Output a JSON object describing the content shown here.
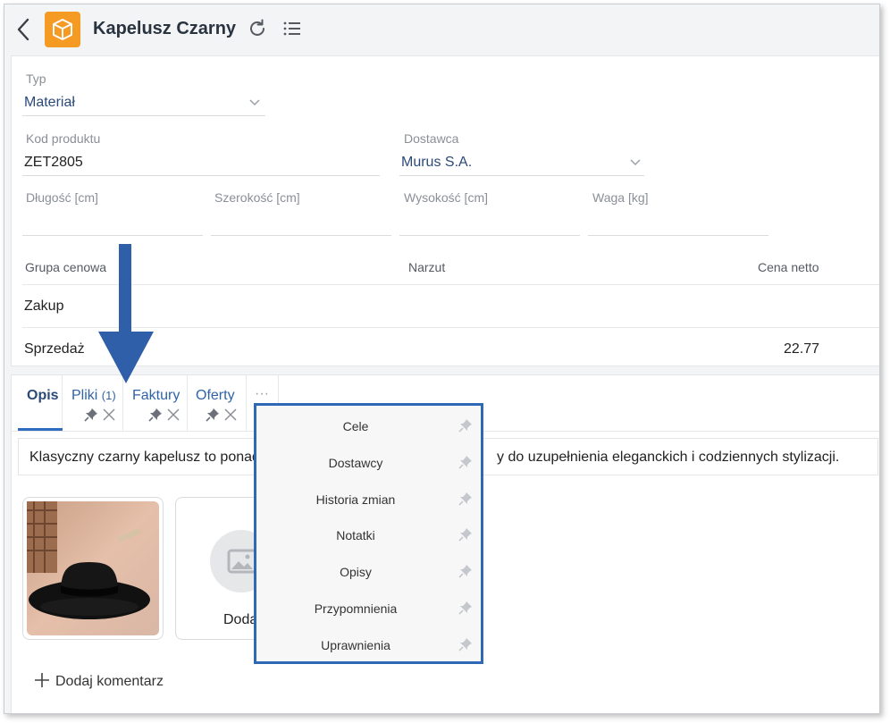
{
  "header": {
    "title": "Kapelusz Czarny"
  },
  "form": {
    "type": {
      "label": "Typ",
      "value": "Materiał"
    },
    "product_code": {
      "label": "Kod produktu",
      "value": "ZET2805"
    },
    "supplier": {
      "label": "Dostawca",
      "value": "Murus S.A."
    },
    "length": {
      "label": "Długość [cm]",
      "value": ""
    },
    "width": {
      "label": "Szerokość [cm]",
      "value": ""
    },
    "height": {
      "label": "Wysokość [cm]",
      "value": ""
    },
    "weight": {
      "label": "Waga [kg]",
      "value": ""
    }
  },
  "price_table": {
    "headers": [
      "Grupa cenowa",
      "Narzut",
      "Cena netto"
    ],
    "rows": [
      {
        "group": "Zakup",
        "markup": "",
        "net": ""
      },
      {
        "group": "Sprzedaż",
        "markup": "",
        "net": "22.77"
      }
    ]
  },
  "tabs": [
    {
      "label": "Opis",
      "count": "",
      "active": true
    },
    {
      "label": "Pliki",
      "count": "(1)",
      "active": false
    },
    {
      "label": "Faktury",
      "count": "",
      "active": false
    },
    {
      "label": "Oferty",
      "count": "",
      "active": false
    },
    {
      "label": "···",
      "count": "",
      "active": false
    }
  ],
  "description": {
    "text_left": "Klasyczny czarny kapelusz to ponad",
    "text_right": "y do uzupełnienia eleganckich i codziennych stylizacji."
  },
  "gallery": {
    "add_label": "Doda"
  },
  "comment": {
    "label": "Dodaj komentarz"
  },
  "menu": {
    "items": [
      "Cele",
      "Dostawcy",
      "Historia zmian",
      "Notatki",
      "Opisy",
      "Przypomnienia",
      "Uprawnienia"
    ]
  },
  "colors": {
    "accent": "#2f68b4",
    "app_icon": "#f59a23",
    "arrow": "#2f5fa8"
  }
}
